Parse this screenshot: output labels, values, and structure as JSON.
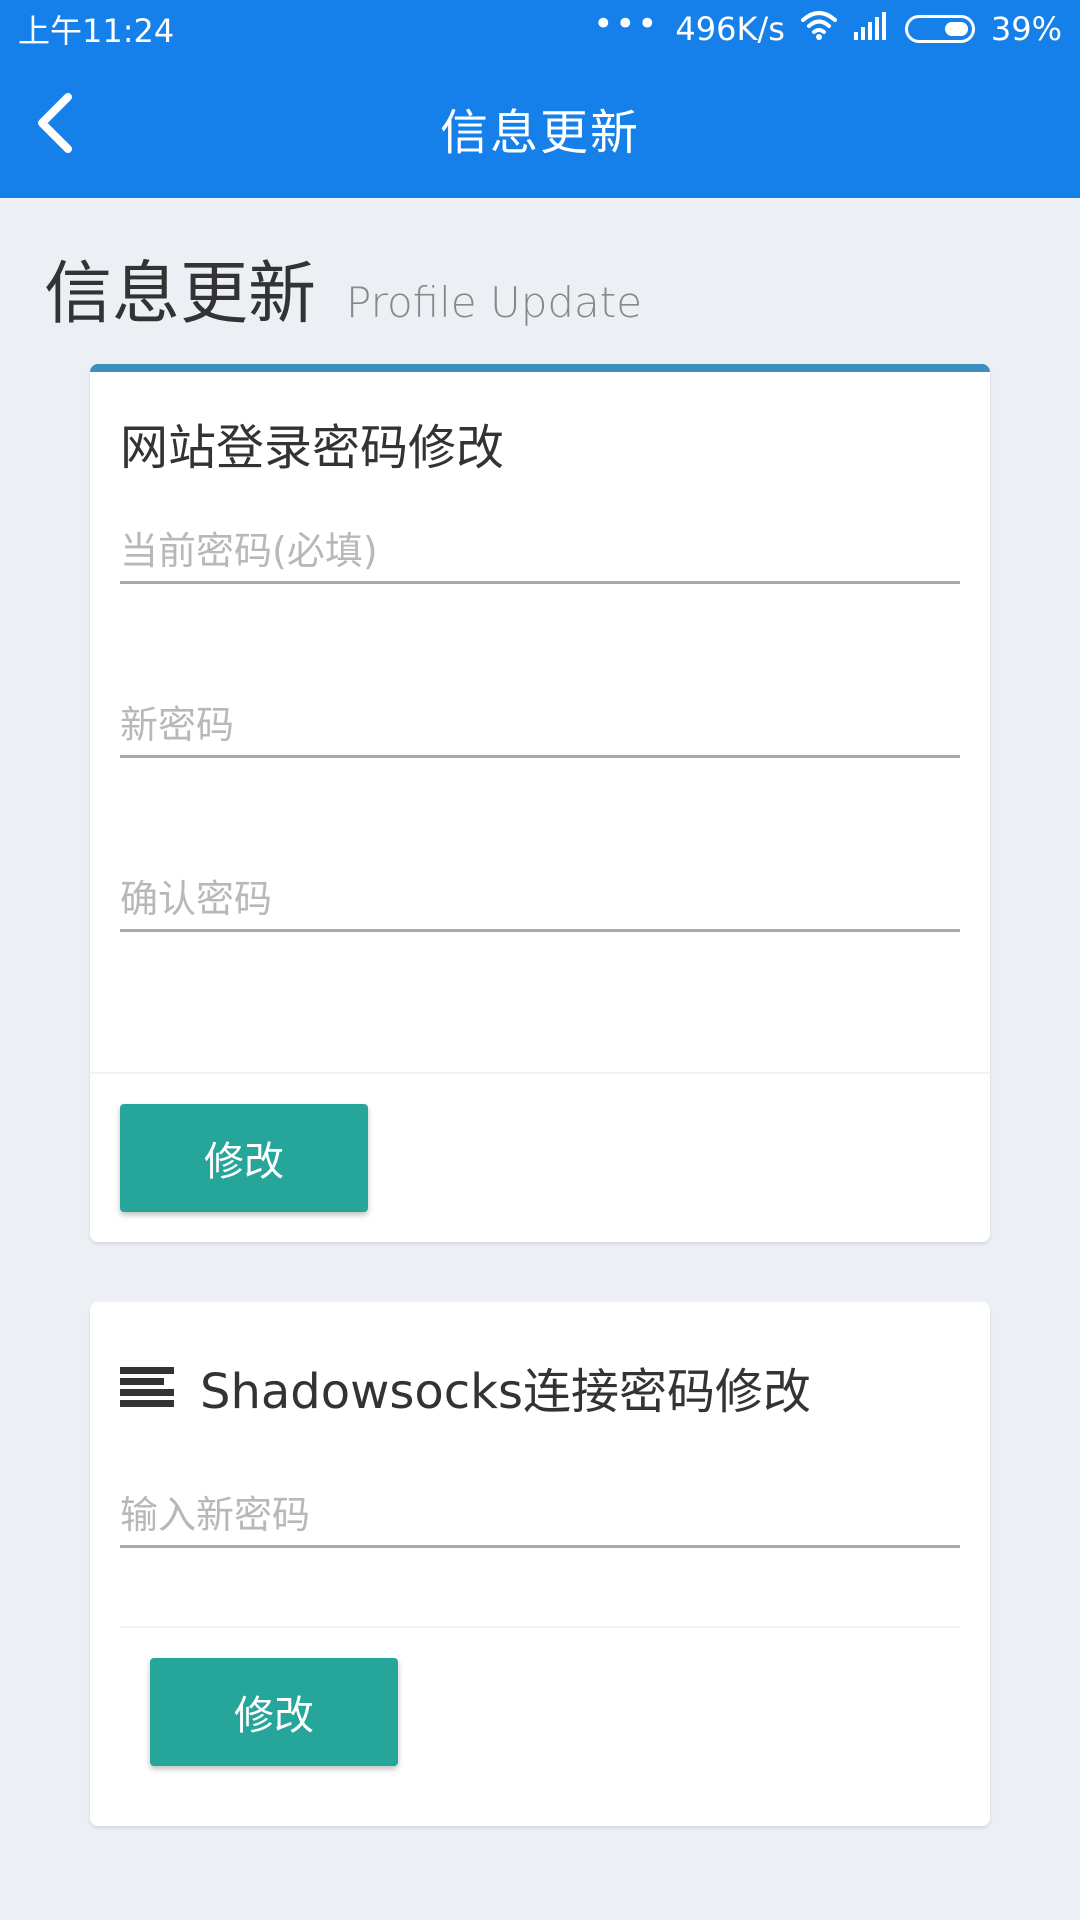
{
  "status_bar": {
    "time": "上午11:24",
    "dots": "•••",
    "speed": "496K/s",
    "battery_percent": "39%",
    "battery_level": 0.39,
    "icons": [
      "wifi-icon",
      "signal-icon",
      "battery-icon"
    ]
  },
  "app_bar": {
    "title": "信息更新",
    "back_icon": "chevron-left-icon"
  },
  "page": {
    "heading": "信息更新",
    "subheading": "Profile Update"
  },
  "password_card": {
    "title": "网站登录密码修改",
    "fields": [
      {
        "placeholder": "当前密码(必填)",
        "value": ""
      },
      {
        "placeholder": "新密码",
        "value": ""
      },
      {
        "placeholder": "确认密码",
        "value": ""
      }
    ],
    "submit_label": "修改",
    "accent_color": "#3c8dbc"
  },
  "ss_card": {
    "title": "Shadowsocks连接密码修改",
    "icon": "list-icon",
    "fields": [
      {
        "placeholder": "输入新密码",
        "value": ""
      }
    ],
    "submit_label": "修改"
  },
  "colors": {
    "primary": "#1680ea",
    "button": "#26a69a",
    "background": "#ecf0f5"
  }
}
